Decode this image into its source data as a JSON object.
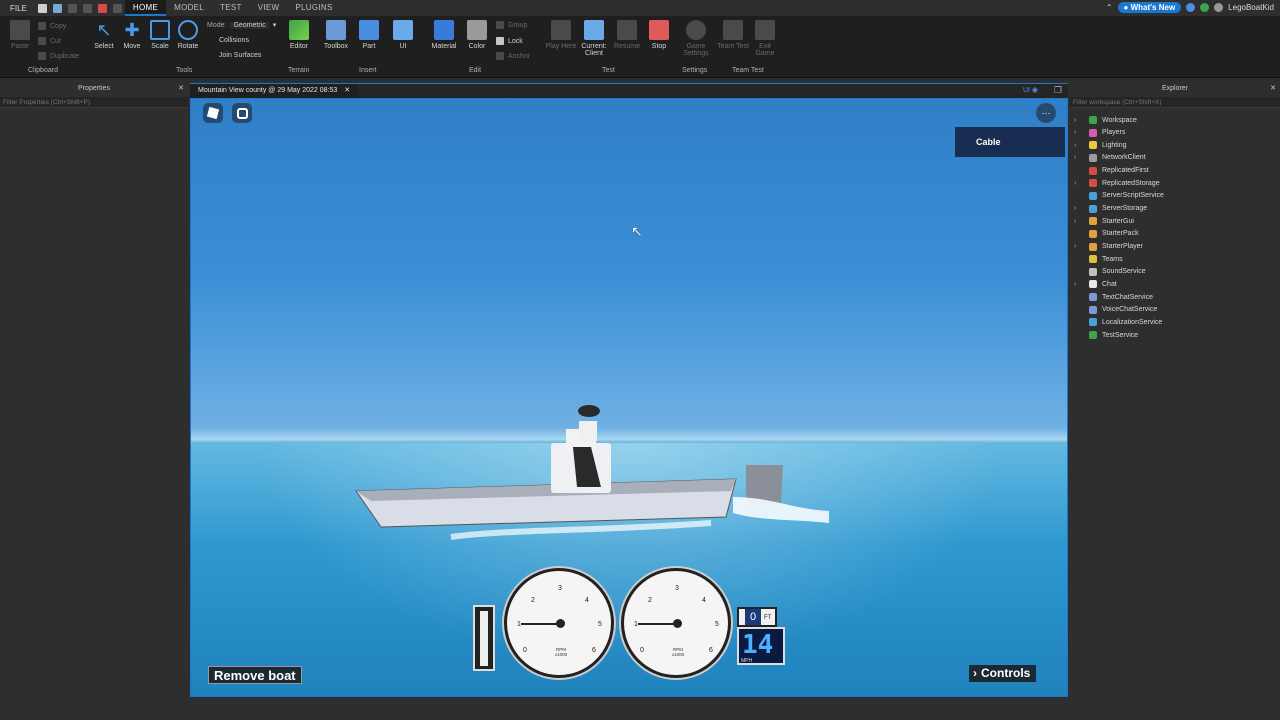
{
  "menu": {
    "file": "FILE",
    "tabs": [
      "HOME",
      "MODEL",
      "TEST",
      "VIEW",
      "PLUGINS"
    ],
    "whats_new": "What's New",
    "username": "LegoBoatKid"
  },
  "ribbon": {
    "clipboard": {
      "paste": "Paste",
      "copy": "Copy",
      "cut": "Cut",
      "duplicate": "Duplicate",
      "group": "Clipboard"
    },
    "tools": {
      "select": "Select",
      "move": "Move",
      "scale": "Scale",
      "rotate": "Rotate",
      "mode_label": "Mode:",
      "mode_value": "Geometric",
      "collisions": "Collisions",
      "join_surfaces": "Join Surfaces",
      "group": "Tools"
    },
    "terrain": {
      "editor": "Editor",
      "group": "Terrain"
    },
    "insert": {
      "toolbox": "Toolbox",
      "part": "Part",
      "ui": "UI",
      "group": "Insert"
    },
    "edit": {
      "material": "Material",
      "color": "Color",
      "group_btn": "Group",
      "lock": "Lock",
      "anchor": "Anchor",
      "group": "Edit"
    },
    "test": {
      "play_here": "Play Here",
      "current_client": "Current: Client",
      "resume": "Resume",
      "stop": "Stop",
      "group": "Test"
    },
    "settings": {
      "game_settings": "Game Settings",
      "group": "Settings"
    },
    "team_test": {
      "team_test": "Team Test",
      "exit_game": "Exit Game",
      "group": "Team Test"
    }
  },
  "properties": {
    "title": "Properties",
    "filter_placeholder": "Filter Properties (Ctrl+Shift+P)"
  },
  "explorer": {
    "title": "Explorer",
    "filter_placeholder": "Filter workspace (Ctrl+Shift+X)",
    "items": [
      {
        "label": "Workspace",
        "expandable": true,
        "color": "#3ea34a"
      },
      {
        "label": "Players",
        "expandable": true,
        "color": "#d85ab0"
      },
      {
        "label": "Lighting",
        "expandable": true,
        "color": "#f0c93a"
      },
      {
        "label": "NetworkClient",
        "expandable": true,
        "color": "#9c9c9c"
      },
      {
        "label": "ReplicatedFirst",
        "expandable": false,
        "color": "#d64a4a"
      },
      {
        "label": "ReplicatedStorage",
        "expandable": true,
        "color": "#d64a4a"
      },
      {
        "label": "ServerScriptService",
        "expandable": false,
        "color": "#4aa0d8"
      },
      {
        "label": "ServerStorage",
        "expandable": true,
        "color": "#4aa0d8"
      },
      {
        "label": "StarterGui",
        "expandable": true,
        "color": "#e0a040"
      },
      {
        "label": "StarterPack",
        "expandable": false,
        "color": "#e0a040"
      },
      {
        "label": "StarterPlayer",
        "expandable": true,
        "color": "#e0a040"
      },
      {
        "label": "Teams",
        "expandable": false,
        "color": "#e0c040"
      },
      {
        "label": "SoundService",
        "expandable": false,
        "color": "#c0c0c0"
      },
      {
        "label": "Chat",
        "expandable": true,
        "color": "#e8e8e8"
      },
      {
        "label": "TextChatService",
        "expandable": false,
        "color": "#7a9ad8"
      },
      {
        "label": "VoiceChatService",
        "expandable": false,
        "color": "#7a9ad8"
      },
      {
        "label": "LocalizationService",
        "expandable": false,
        "color": "#4aa0d8"
      },
      {
        "label": "TestService",
        "expandable": false,
        "color": "#3ea34a"
      }
    ]
  },
  "viewport": {
    "tab_title": "Mountain View county @ 29 May 2022 08:53",
    "ui_toggle": "UI",
    "cable_button": "Cable",
    "remove_boat": "Remove boat",
    "controls": "Controls",
    "gauge_caption": "RPM x1000",
    "gauge_numbers": [
      "0",
      "1",
      "2",
      "3",
      "4",
      "5",
      "6"
    ],
    "depth_value": "0",
    "depth_unit": "FT",
    "speed_value": "14",
    "speed_unit": "MPH"
  }
}
